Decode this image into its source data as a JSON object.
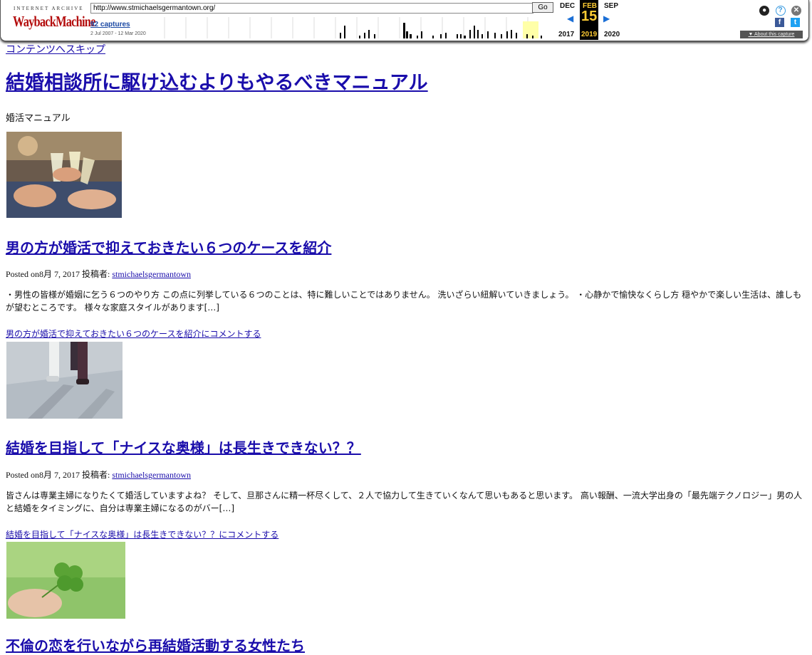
{
  "wayback": {
    "logo_top": "INTERNET ARCHIVE",
    "logo_main": "WaybackMachine",
    "url": "http://www.stmichaelsgermantown.org/",
    "go_label": "Go",
    "captures_label": "92 captures",
    "date_range": "2 Jul 2007 - 12 Mar 2020",
    "prev_month": "DEC",
    "cur_month": "FEB",
    "next_month": "SEP",
    "day": "15",
    "prev_year": "2017",
    "cur_year": "2019",
    "next_year": "2020",
    "about_label": "▼ About this capture",
    "colors": {
      "active": "#000000",
      "day": "#ffcc33",
      "arrow": "#1b6fd6"
    },
    "icons": [
      "user-icon",
      "help-icon",
      "close-icon",
      "facebook-icon",
      "twitter-icon"
    ]
  },
  "page": {
    "skip_link": "コンテンツへスキップ",
    "site_title": "結婚相談所に駆け込むよりもやるべきマニュアル",
    "tagline": "婚活マニュアル"
  },
  "posts": [
    {
      "title": "男の方が婚活で抑えておきたい６つのケースを紹介",
      "posted_on": "Posted on8月 7, 2017 投稿者: ",
      "author": "stmichaelsgermantown",
      "excerpt": "・男性の皆様が婚姻に乞う６つのやり方 この点に列挙している６つのことは、特に難しいことではありません。 洗いざらい紐解いていきましょう。 ・心静かで愉快なくらし方 穏やかで楽しい生活は、誰しもが望むところです。 様々な家庭スタイルがあります[…]",
      "comment_link": "男の方が婚活で抑えておきたい６つのケースを紹介にコメントする"
    },
    {
      "title": "結婚を目指して「ナイスな奥様」は長生きできない？？",
      "posted_on": "Posted on8月 7, 2017 投稿者: ",
      "author": "stmichaelsgermantown",
      "excerpt": "皆さんは専業主婦になりたくて婚活していますよね？ そして、旦那さんに精一杯尽くして、２人で協力して生きていくなんて思いもあると思います。 高い報酬、一流大学出身の「最先端テクノロジー」男の人と結婚をタイミングに、自分は専業主婦になるのがバー[…]",
      "comment_link": "結婚を目指して「ナイスな奥様」は長生きできない？？にコメントする"
    },
    {
      "title": "不倫の恋を行いながら再結婚活動する女性たち"
    }
  ]
}
